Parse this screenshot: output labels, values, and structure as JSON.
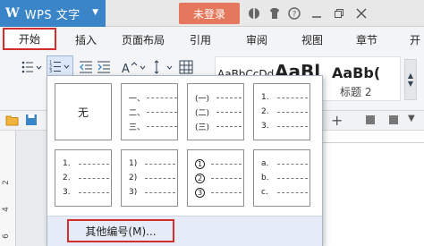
{
  "titlebar": {
    "app_logo": "W",
    "app_title": "WPS 文字",
    "login_label": "未登录",
    "icons": [
      "theme-icon",
      "skin-icon",
      "help-icon",
      "minimize-icon",
      "restore-icon",
      "close-icon"
    ]
  },
  "menu": {
    "tabs": [
      "开始",
      "插入",
      "页面布局",
      "引用",
      "审阅",
      "视图",
      "章节",
      "开"
    ],
    "active": "开始"
  },
  "ribbon": {
    "styles": [
      {
        "sample": "AaBbCcDd"
      },
      {
        "sample": "AaBl"
      },
      {
        "sample": "AaBb("
      }
    ],
    "style_label": "标题 2"
  },
  "numbering": {
    "none_label": "无",
    "cells": [
      {
        "markers": [
          "一、",
          "二、",
          "三、"
        ]
      },
      {
        "markers": [
          "(一)",
          "(二)",
          "(三)"
        ]
      },
      {
        "markers": [
          "1.",
          "2.",
          "3."
        ]
      },
      {
        "markers": [
          "1.",
          "2.",
          "3."
        ]
      },
      {
        "markers": [
          "1)",
          "2)",
          "3)"
        ]
      },
      {
        "markers": [
          "1",
          "2",
          "3"
        ],
        "circled": true
      },
      {
        "markers": [
          "a.",
          "b.",
          "c."
        ]
      }
    ],
    "more_label": "其他编号(M)..."
  },
  "ruler": {
    "left_marks": [
      "2",
      "4",
      "6"
    ]
  }
}
